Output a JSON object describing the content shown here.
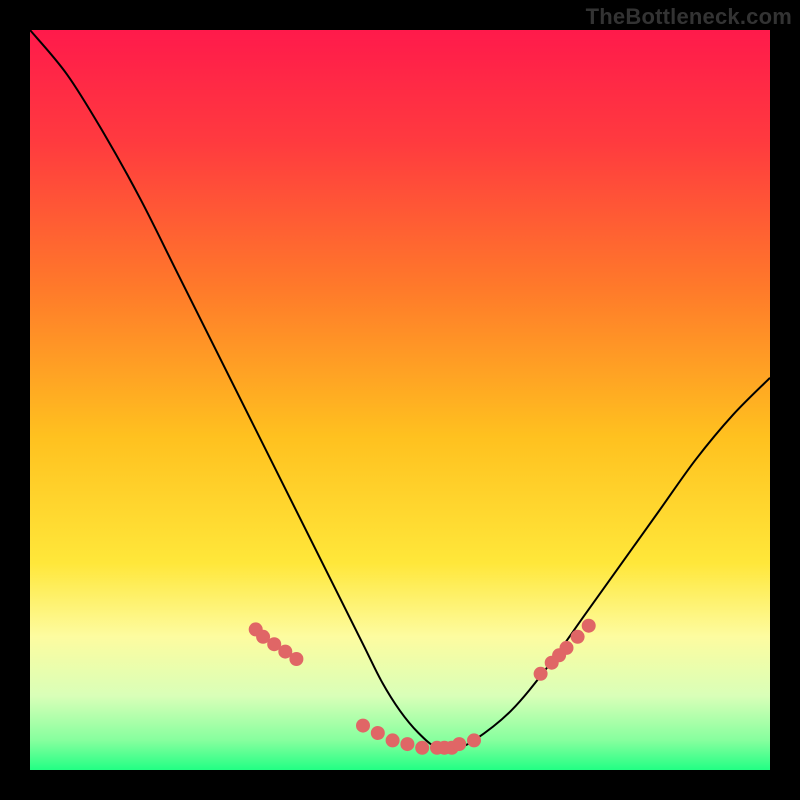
{
  "watermark": "TheBottleneck.com",
  "chart_data": {
    "type": "line",
    "title": "",
    "xlabel": "",
    "ylabel": "",
    "xlim": [
      0,
      1
    ],
    "ylim": [
      0,
      1
    ],
    "gradient_stops": [
      {
        "offset": 0.0,
        "color": "#ff1a4b"
      },
      {
        "offset": 0.15,
        "color": "#ff3a3f"
      },
      {
        "offset": 0.35,
        "color": "#ff7a2a"
      },
      {
        "offset": 0.55,
        "color": "#ffc11f"
      },
      {
        "offset": 0.72,
        "color": "#ffe73a"
      },
      {
        "offset": 0.82,
        "color": "#fdfca0"
      },
      {
        "offset": 0.9,
        "color": "#d9ffb8"
      },
      {
        "offset": 0.96,
        "color": "#86ff9e"
      },
      {
        "offset": 1.0,
        "color": "#22ff84"
      }
    ],
    "series": [
      {
        "name": "bottleneck-curve",
        "color": "#000000",
        "x": [
          0.0,
          0.05,
          0.1,
          0.15,
          0.2,
          0.25,
          0.3,
          0.35,
          0.4,
          0.45,
          0.475,
          0.5,
          0.525,
          0.55,
          0.575,
          0.6,
          0.65,
          0.7,
          0.75,
          0.8,
          0.85,
          0.9,
          0.95,
          1.0
        ],
        "y": [
          1.0,
          0.94,
          0.86,
          0.77,
          0.67,
          0.57,
          0.47,
          0.37,
          0.27,
          0.17,
          0.12,
          0.08,
          0.05,
          0.03,
          0.03,
          0.04,
          0.08,
          0.14,
          0.21,
          0.28,
          0.35,
          0.42,
          0.48,
          0.53
        ]
      }
    ],
    "highlight_points": {
      "name": "curve-markers",
      "color": "#e06666",
      "radius": 7,
      "x": [
        0.305,
        0.315,
        0.33,
        0.345,
        0.36,
        0.45,
        0.47,
        0.49,
        0.51,
        0.53,
        0.55,
        0.56,
        0.57,
        0.58,
        0.6,
        0.69,
        0.705,
        0.715,
        0.725,
        0.74,
        0.755
      ],
      "y": [
        0.19,
        0.18,
        0.17,
        0.16,
        0.15,
        0.06,
        0.05,
        0.04,
        0.035,
        0.03,
        0.03,
        0.03,
        0.03,
        0.035,
        0.04,
        0.13,
        0.145,
        0.155,
        0.165,
        0.18,
        0.195
      ]
    }
  }
}
